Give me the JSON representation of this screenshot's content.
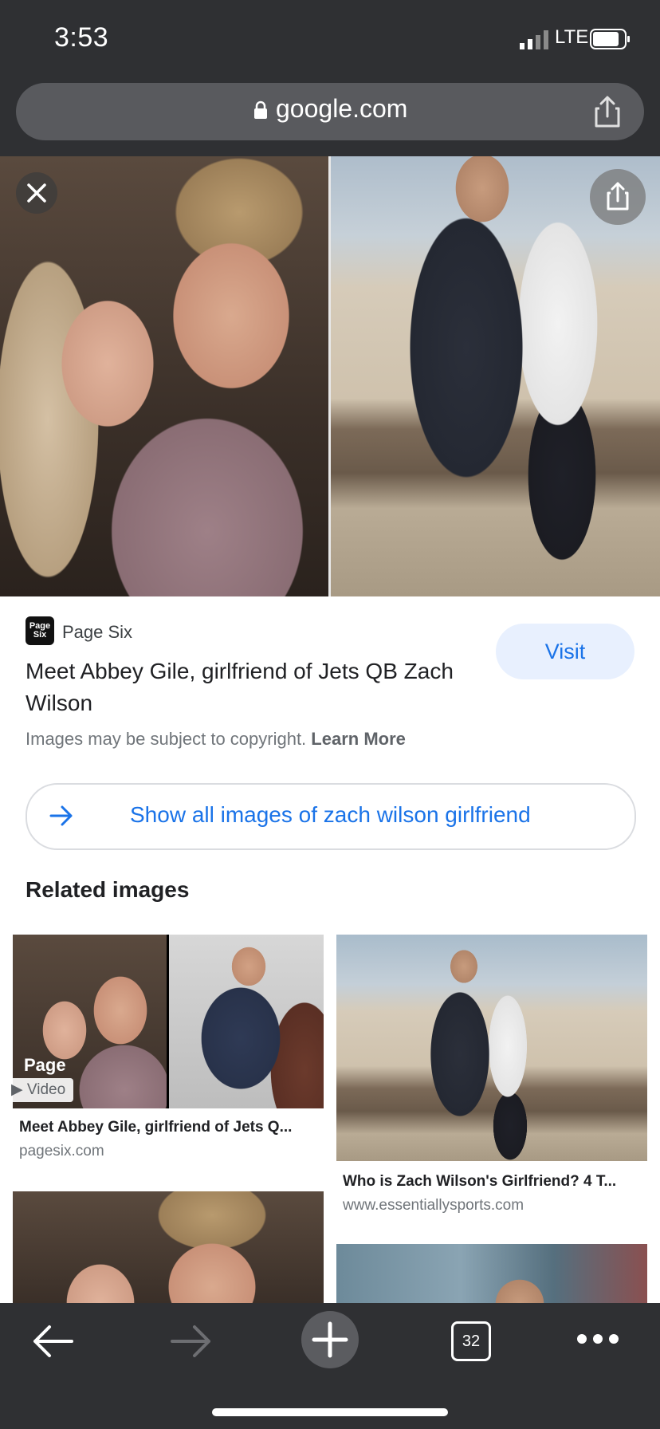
{
  "status_bar": {
    "time": "3:53",
    "network": "LTE"
  },
  "url_bar": {
    "url": "google.com"
  },
  "result": {
    "source_logo_text": "Page Six",
    "source_name": "Page Six",
    "title": "Meet Abbey Gile, girlfriend of Jets QB Zach Wilson",
    "visit_label": "Visit",
    "copyright_text": "Images may be subject to copyright.",
    "learn_more": "Learn More",
    "show_all_label": "Show all images of zach wilson girlfriend"
  },
  "related": {
    "heading": "Related images",
    "items": [
      {
        "title": "Meet Abbey Gile, girlfriend of Jets Q...",
        "source": "pagesix.com",
        "badge": "Video",
        "overlay_text": "Page"
      },
      {
        "title": "Who is Zach Wilson's Girlfriend? 4 T...",
        "source": "www.essentiallysports.com"
      }
    ]
  },
  "toolbar": {
    "tab_count": "32"
  },
  "icons": {
    "close": "close-icon",
    "share": "share-icon",
    "lock": "lock-icon",
    "arrow": "arrow-right-icon",
    "back": "back-arrow-icon",
    "forward": "forward-arrow-icon",
    "new_tab": "plus-icon",
    "more": "more-dots-icon"
  },
  "colors": {
    "chrome": "#2f3033",
    "link_blue": "#1a73e8",
    "visit_bg": "#e8f0fe"
  }
}
